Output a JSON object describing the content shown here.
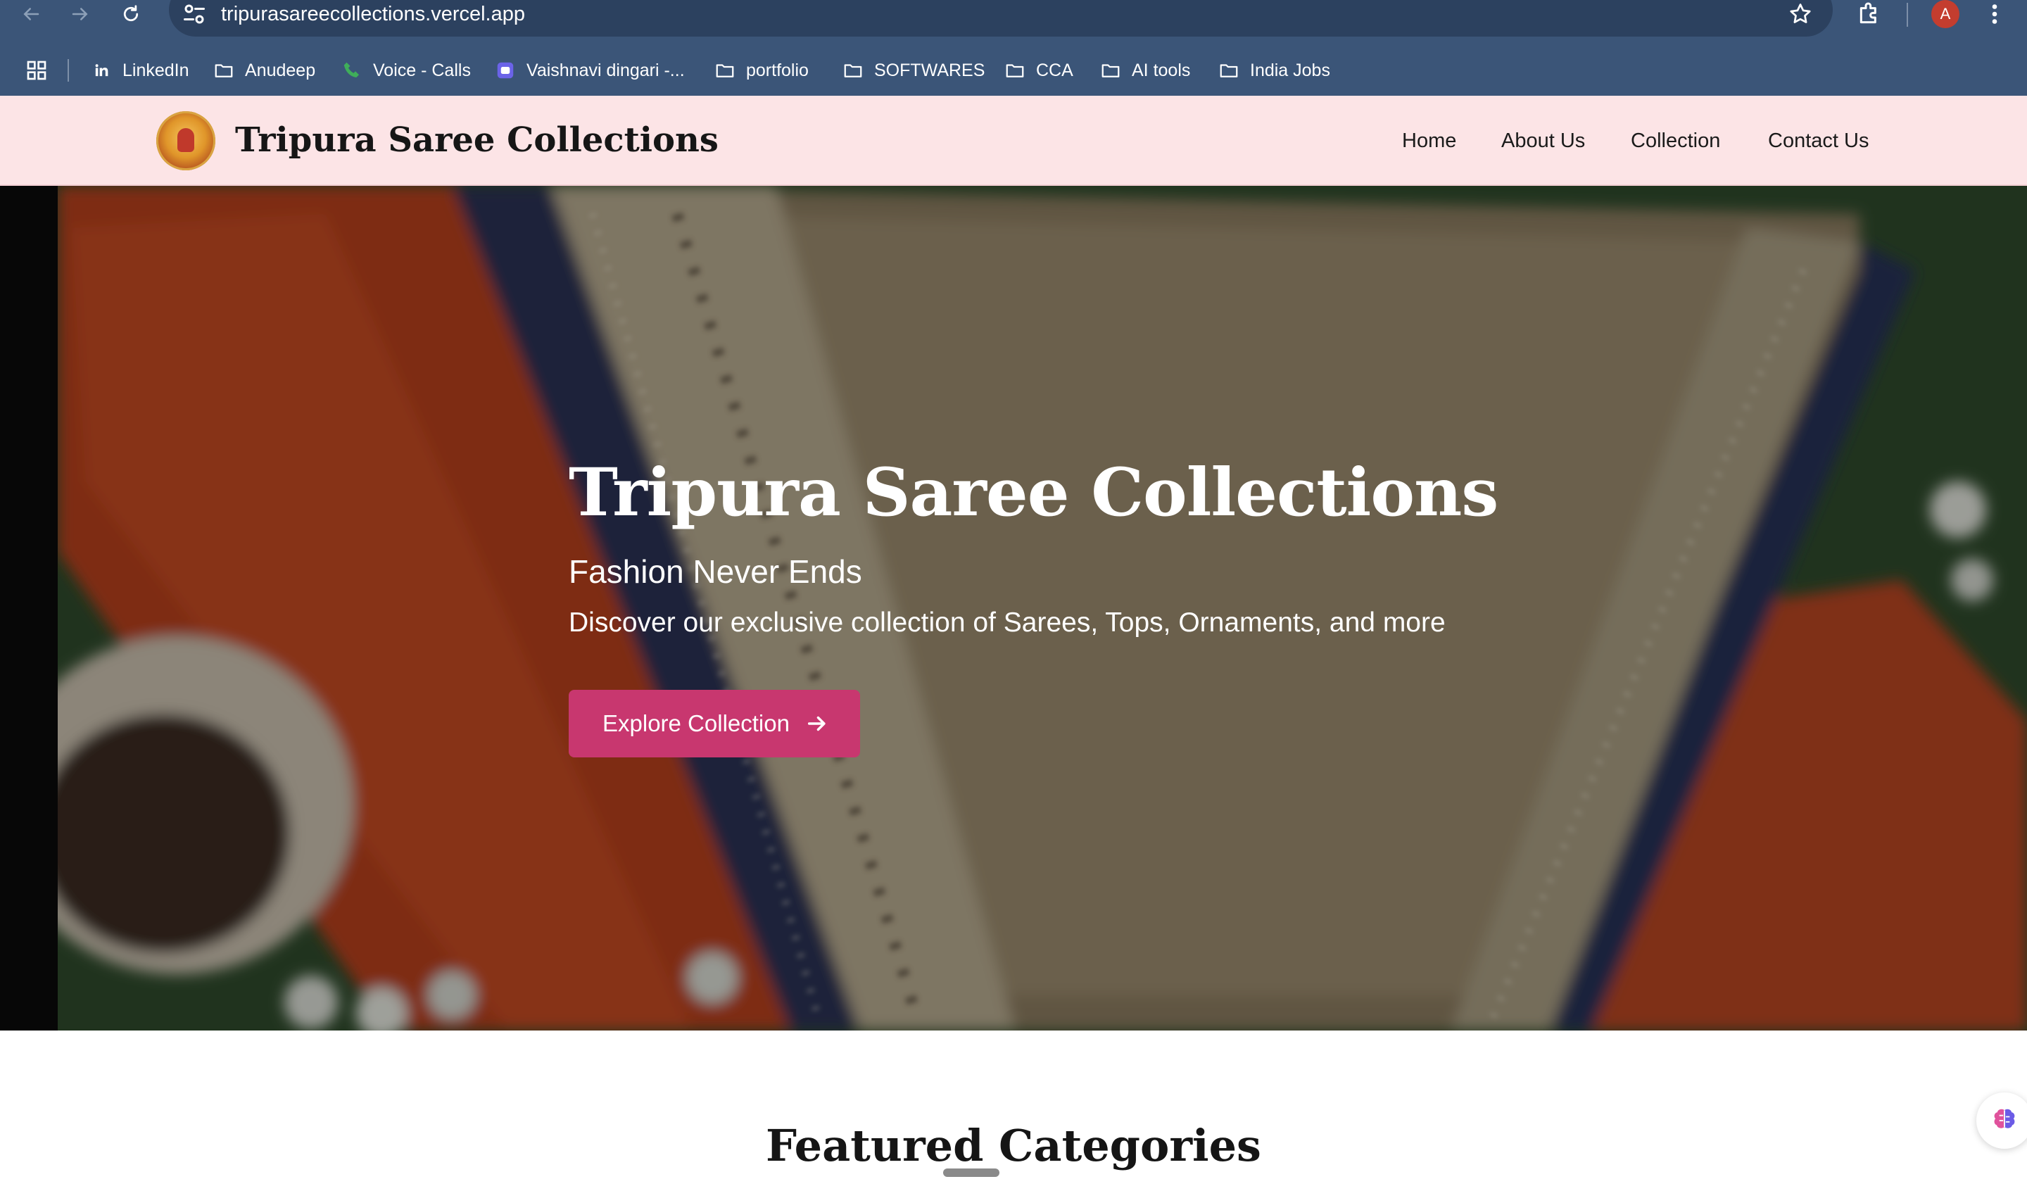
{
  "browser": {
    "url": "tripurasareecollections.vercel.app",
    "avatar_letter": "A",
    "bookmarks": [
      {
        "label": "LinkedIn",
        "icon": "linkedin-icon"
      },
      {
        "label": "Anudeep",
        "icon": "folder-icon"
      },
      {
        "label": "Voice - Calls",
        "icon": "phone-icon"
      },
      {
        "label": "Vaishnavi dingari -...",
        "icon": "app-icon"
      },
      {
        "label": "portfolio",
        "icon": "folder-icon"
      },
      {
        "label": "SOFTWARES",
        "icon": "folder-icon"
      },
      {
        "label": "CCA",
        "icon": "folder-icon"
      },
      {
        "label": "AI tools",
        "icon": "folder-icon"
      },
      {
        "label": "India Jobs",
        "icon": "folder-icon"
      }
    ]
  },
  "header": {
    "brand": "Tripura Saree Collections",
    "nav": [
      {
        "label": "Home"
      },
      {
        "label": "About Us"
      },
      {
        "label": "Collection"
      },
      {
        "label": "Contact Us"
      }
    ]
  },
  "hero": {
    "title": "Tripura Saree Collections",
    "subtitle": "Fashion Never Ends",
    "description": "Discover our exclusive collection of Sarees, Tops, Ornaments, and more",
    "cta_label": "Explore Collection"
  },
  "featured": {
    "title": "Featured Categories"
  },
  "colors": {
    "chrome": "#3b5578",
    "header_bg": "#fce4e6",
    "accent": "#c8376f"
  }
}
